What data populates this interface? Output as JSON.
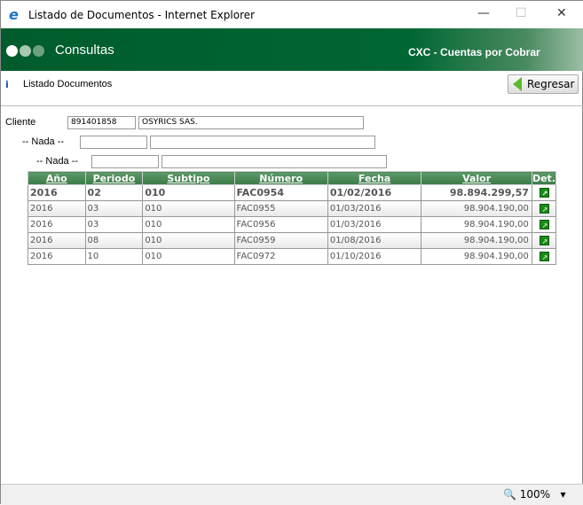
{
  "window": {
    "title": "Listado de Documentos - Internet Explorer",
    "minimize": "—",
    "maximize": "☐",
    "close": "✕"
  },
  "banner": {
    "title": "Consultas",
    "module": "CXC - Cuentas por Cobrar"
  },
  "subheader": {
    "title": "Listado Documentos",
    "back_label": "Regresar"
  },
  "filters": {
    "cliente_label": "Cliente",
    "cliente_code": "891401858",
    "cliente_name": "OSYRICS SAS.",
    "nada1_label": "-- Nada --",
    "nada2_label": "-- Nada --"
  },
  "table": {
    "headers": [
      "Año",
      "Periodo",
      "Subtipo",
      "Número",
      "Fecha",
      "Valor",
      "Det."
    ],
    "rows": [
      [
        "2016",
        "02",
        "010",
        "FAC0954",
        "01/02/2016",
        "98.894.299,57"
      ],
      [
        "2016",
        "03",
        "010",
        "FAC0955",
        "01/03/2016",
        "98.904.190,00"
      ],
      [
        "2016",
        "03",
        "010",
        "FAC0956",
        "01/03/2016",
        "98.904.190,00"
      ],
      [
        "2016",
        "08",
        "010",
        "FAC0959",
        "01/08/2016",
        "98.904.190,00"
      ],
      [
        "2016",
        "10",
        "010",
        "FAC0972",
        "01/10/2016",
        "98.904.190,00"
      ]
    ]
  },
  "status": {
    "zoom": "100%"
  }
}
